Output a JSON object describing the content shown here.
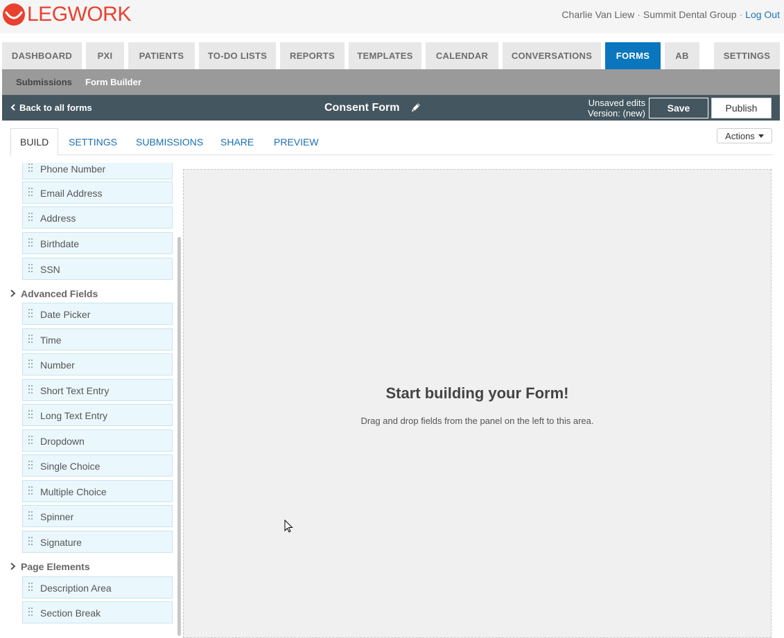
{
  "header": {
    "logo_text": "LEGWORK",
    "brand_color": "#e8412f",
    "user_name": "Charlie Van Liew",
    "separator": "·",
    "org": "Summit Dental Group",
    "logout": "Log Out"
  },
  "nav": {
    "tabs": [
      "DASHBOARD",
      "PXI",
      "PATIENTS",
      "TO-DO LISTS",
      "REPORTS",
      "TEMPLATES",
      "CALENDAR",
      "CONVERSATIONS",
      "FORMS",
      "AB",
      "SETTINGS"
    ],
    "active": "FORMS",
    "active_color": "#0a76be"
  },
  "subnav": {
    "submissions": "Submissions",
    "form_builder": "Form Builder"
  },
  "toolbar": {
    "back": "Back to all forms",
    "form_title": "Consent Form",
    "unsaved_line1": "Unsaved edits",
    "unsaved_line2": "Version: (new)",
    "save": "Save",
    "publish": "Publish"
  },
  "builder_tabs": {
    "tabs": [
      "BUILD",
      "SETTINGS",
      "SUBMISSIONS",
      "SHARE",
      "PREVIEW"
    ],
    "active": "BUILD",
    "actions": "Actions"
  },
  "panel": {
    "partial_field": "Phone Number",
    "basic_fields": [
      "Email Address",
      "Address",
      "Birthdate",
      "SSN"
    ],
    "advanced_heading": "Advanced Fields",
    "advanced_fields": [
      "Date Picker",
      "Time",
      "Number",
      "Short Text Entry",
      "Long Text Entry",
      "Dropdown",
      "Single Choice",
      "Multiple Choice",
      "Spinner",
      "Signature"
    ],
    "page_heading": "Page Elements",
    "page_fields": [
      "Description Area",
      "Section Break"
    ]
  },
  "canvas": {
    "title": "Start building your Form!",
    "subtitle": "Drag and drop fields from the panel on the left to this area."
  }
}
